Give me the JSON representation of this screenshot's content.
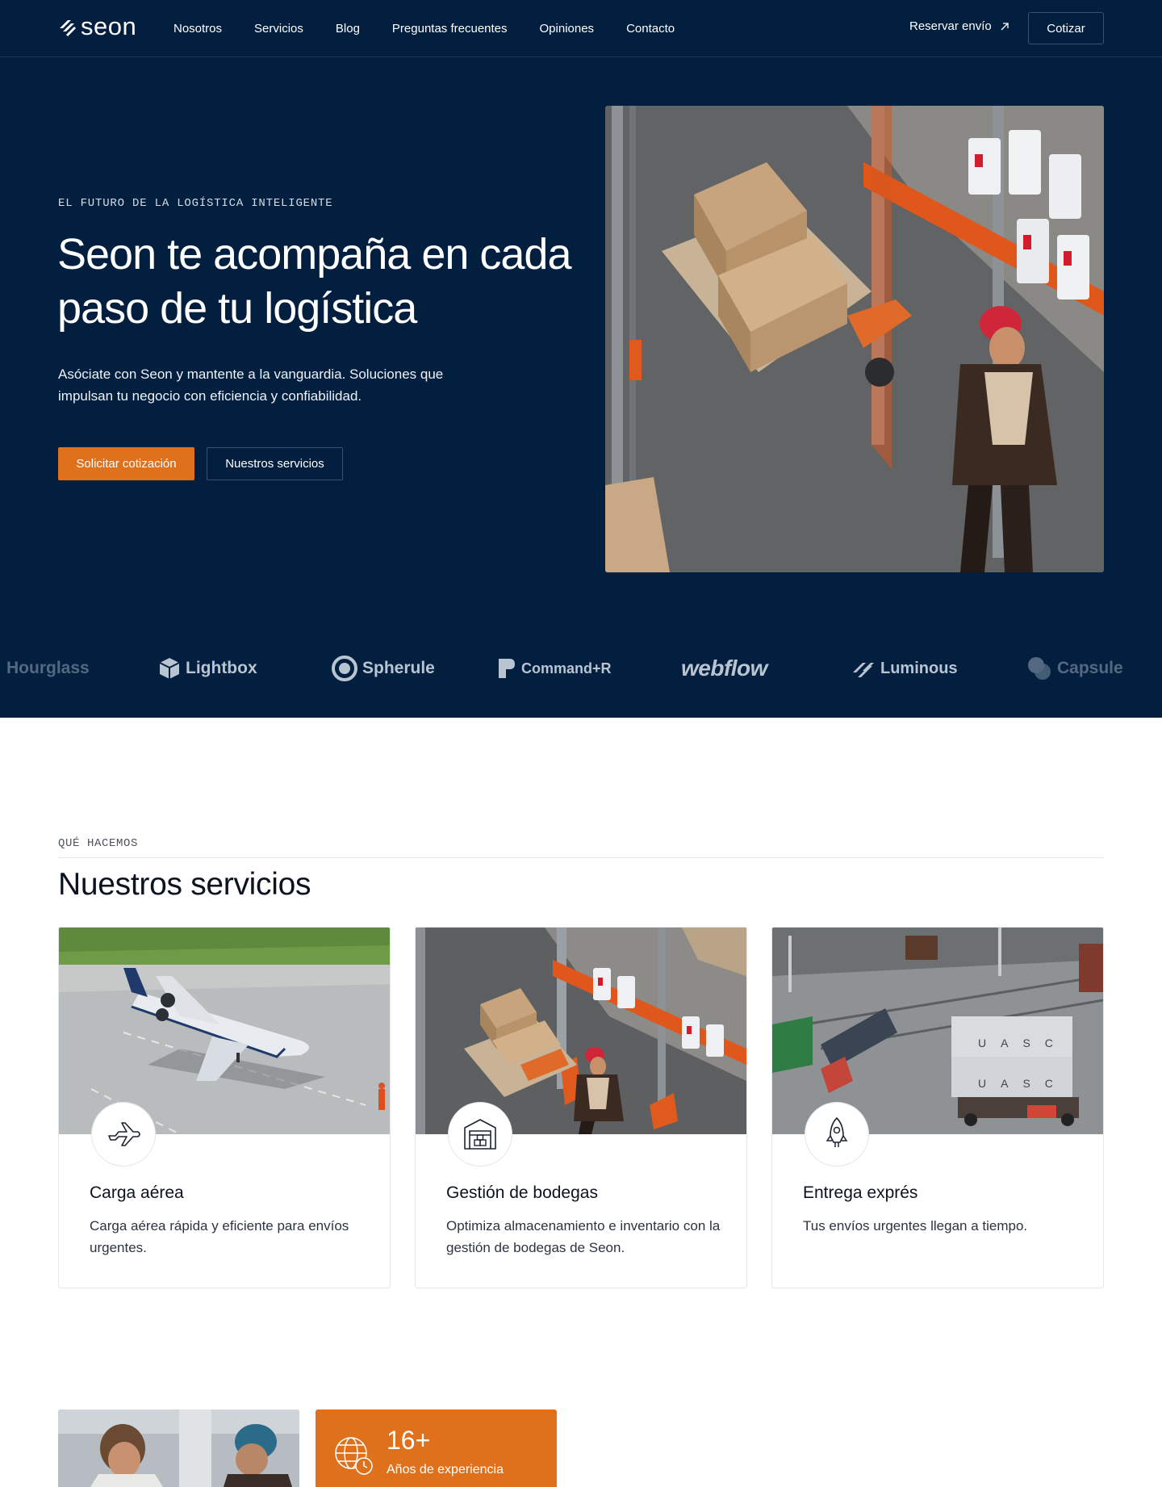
{
  "header": {
    "logo_text": "seon",
    "nav": [
      "Nosotros",
      "Servicios",
      "Blog",
      "Preguntas frecuentes",
      "Opiniones",
      "Contacto"
    ],
    "reserve_label": "Reservar envío",
    "quote_label": "Cotizar"
  },
  "hero": {
    "eyebrow": "EL FUTURO DE LA LOGÍSTICA INTELIGENTE",
    "title": "Seon te acompaña en cada paso de tu logística",
    "subtitle": "Asóciate con Seon y mantente a la vanguardia. Soluciones que impulsan tu negocio con eficiencia y confiabilidad.",
    "primary_button": "Solicitar cotización",
    "secondary_button": "Nuestros servicios"
  },
  "partners": [
    "Hourglass",
    "Lightbox",
    "Spherule",
    "Command+R",
    "webflow",
    "Luminous",
    "Capsule"
  ],
  "services": {
    "eyebrow": "QUÉ HACEMOS",
    "title": "Nuestros servicios",
    "cards": [
      {
        "title": "Carga aérea",
        "description": "Carga aérea rápida y eficiente para envíos urgentes.",
        "icon": "airplane-icon"
      },
      {
        "title": "Gestión de bodegas",
        "description": "Optimiza almacenamiento e inventario con la gestión de bodegas de Seon.",
        "icon": "warehouse-icon"
      },
      {
        "title": "Entrega exprés",
        "description": "Tus envíos urgentes llegan a tiempo.",
        "icon": "rocket-icon"
      }
    ]
  },
  "stats": {
    "value": "16+",
    "label": "Años de experiencia",
    "icon": "globe-clock-icon"
  },
  "colors": {
    "navy": "#021f3f",
    "accent": "#e0711c"
  }
}
